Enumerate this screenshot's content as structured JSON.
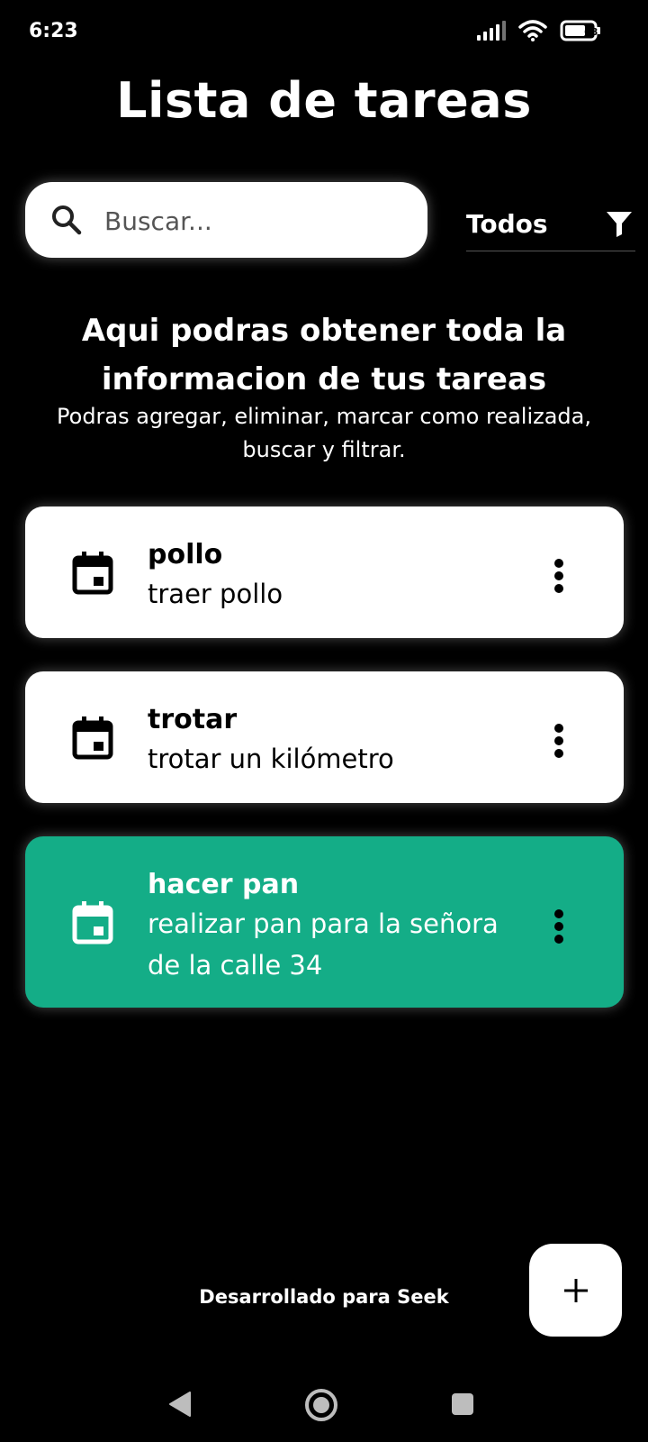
{
  "status_bar": {
    "time": "6:23",
    "battery": "68"
  },
  "header": {
    "title": "Lista de tareas"
  },
  "search": {
    "placeholder": "Buscar...",
    "value": ""
  },
  "filter": {
    "selected": "Todos"
  },
  "intro": {
    "title": "Aqui podras obtener toda la informacion de tus tareas",
    "subtitle": "Podras agregar, eliminar, marcar como realizada, buscar y filtrar."
  },
  "tasks": [
    {
      "title": "pollo",
      "description": "traer pollo",
      "done": false
    },
    {
      "title": "trotar",
      "description": "trotar un kilómetro",
      "done": false
    },
    {
      "title": "hacer pan",
      "description": "realizar pan para la señora de la calle 34",
      "done": true
    }
  ],
  "footer": {
    "text": "Desarrollado para Seek"
  },
  "fab": {
    "icon": "plus-icon"
  },
  "colors": {
    "done_card": "#14ad87",
    "background": "#000000",
    "card": "#ffffff"
  }
}
